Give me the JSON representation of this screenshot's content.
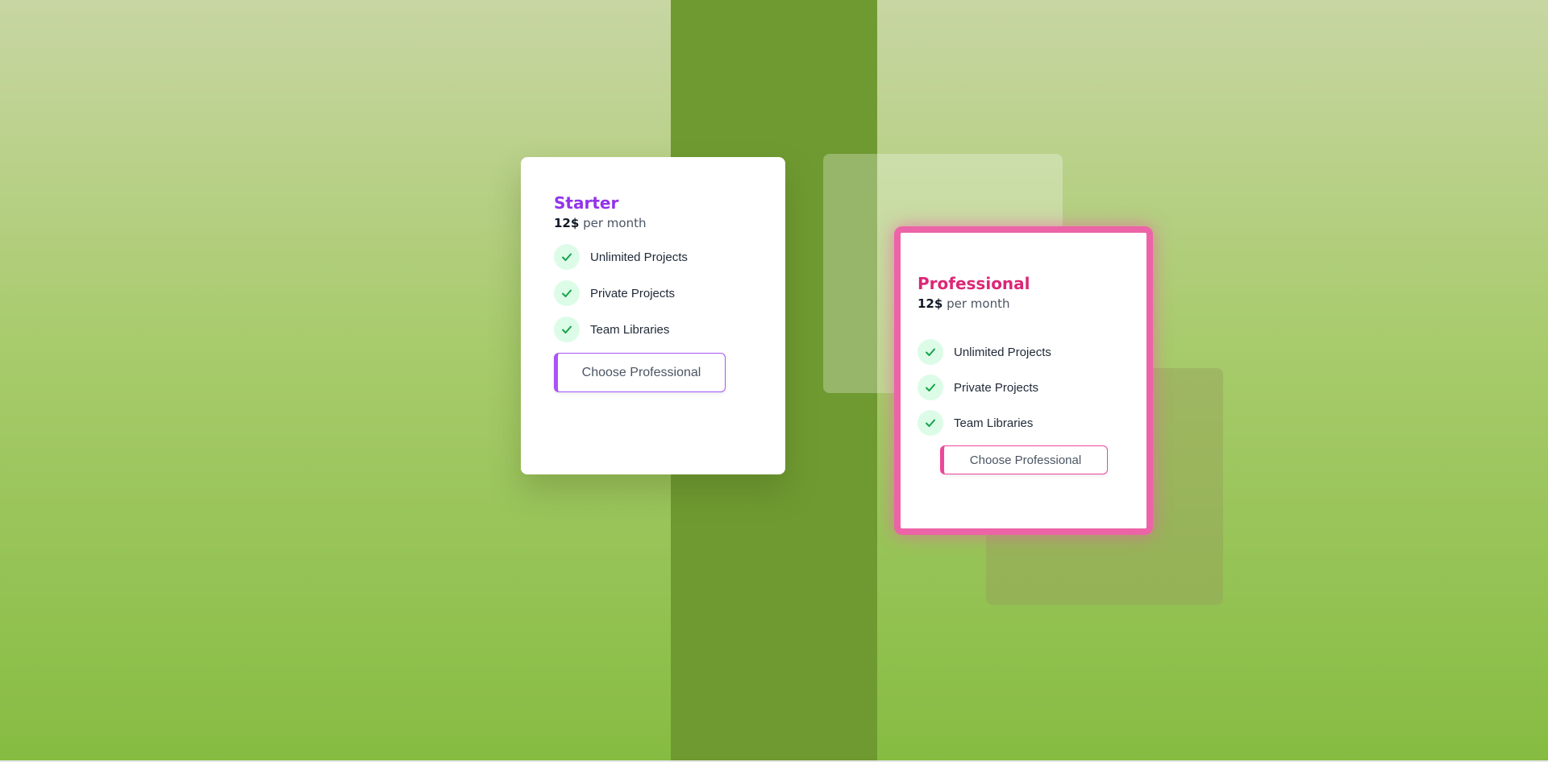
{
  "colors": {
    "starter_accent": "#9333ea",
    "professional_accent": "#db2777",
    "professional_border": "#ec64a7",
    "check_bg": "#dcfce7",
    "check_color": "#16a34a"
  },
  "plans": [
    {
      "name": "Starter",
      "price": "12$",
      "period": "per month",
      "features": [
        "Unlimited Projects",
        "Private Projects",
        "Team Libraries"
      ],
      "button_label": "Choose Professional",
      "feature_icon": "check-icon"
    },
    {
      "name": "Professional",
      "price": "12$",
      "period": "per month",
      "features": [
        "Unlimited Projects",
        "Private Projects",
        "Team Libraries"
      ],
      "button_label": "Choose Professional",
      "feature_icon": "check-icon"
    }
  ]
}
